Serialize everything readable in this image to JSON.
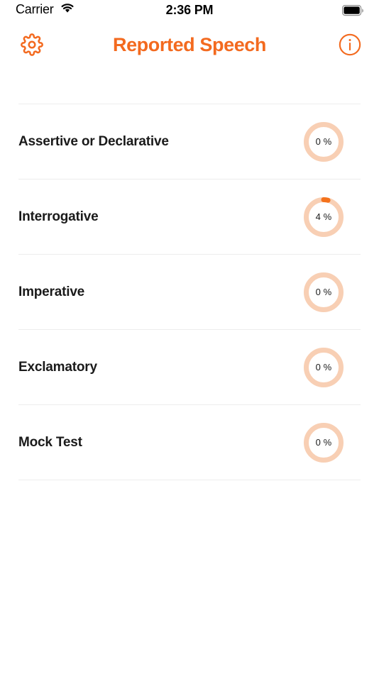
{
  "status_bar": {
    "carrier": "Carrier",
    "wifi_icon": "wifi-icon",
    "time": "2:36 PM",
    "battery_icon": "battery-full-icon"
  },
  "nav": {
    "title": "Reported Speech",
    "settings_icon": "gear-icon",
    "info_icon": "info-circle-icon"
  },
  "colors": {
    "accent": "#F36A1F",
    "progress_track": "#F8CFB4",
    "progress_fill": "#F4721C",
    "divider": "#EDEDED",
    "label": "#1A1A1A"
  },
  "list": {
    "rows": [
      {
        "label": "Assertive or Declarative",
        "percent": 0,
        "percent_label": "0 %"
      },
      {
        "label": "Interrogative",
        "percent": 4,
        "percent_label": "4 %"
      },
      {
        "label": "Imperative",
        "percent": 0,
        "percent_label": "0 %"
      },
      {
        "label": "Exclamatory",
        "percent": 0,
        "percent_label": "0 %"
      },
      {
        "label": "Mock Test",
        "percent": 0,
        "percent_label": "0 %"
      }
    ]
  }
}
